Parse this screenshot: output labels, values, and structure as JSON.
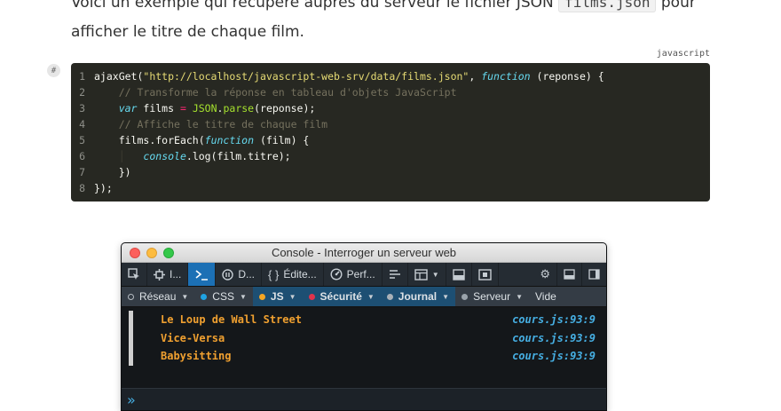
{
  "prose": {
    "line1_prefix": "Voici un exemple qui récupère auprès du serveur le fichier JSON ",
    "line1_code": "films.json",
    "line1_suffix": " pour",
    "line2": "afficher le titre de chaque film."
  },
  "code_block": {
    "language": "javascript",
    "anchor_label": "#",
    "lines": [
      {
        "n": "1"
      },
      {
        "n": "2"
      },
      {
        "n": "3"
      },
      {
        "n": "4"
      },
      {
        "n": "5"
      },
      {
        "n": "6"
      },
      {
        "n": "7"
      },
      {
        "n": "8"
      }
    ],
    "tokens": {
      "l1_a": "ajaxGet(",
      "l1_str": "\"http://localhost/javascript-web-srv/data/films.json\"",
      "l1_b": ", ",
      "l1_kw": "function",
      "l1_c": " (reponse) {",
      "l2_com": "// Transforme la réponse en tableau d'objets JavaScript",
      "l3_kw": "var",
      "l3_a": " films ",
      "l3_op": "=",
      "l3_sp": " ",
      "l3_obj": "JSON",
      "l3_b": ".",
      "l3_fn": "parse",
      "l3_c": "(reponse);",
      "l4_com": "// Affiche le titre de chaque film",
      "l5_a": "films.forEach(",
      "l5_kw": "function",
      "l5_b": " (film) {",
      "l6_kw": "console",
      "l6_a": ".log(film.titre);",
      "l7_a": "})",
      "l8_a": "});"
    }
  },
  "devtools": {
    "window_title": "Console - Interroger un serveur web",
    "toolbar": {
      "inspector": "I...",
      "debugger": "D...",
      "style_editor": "Édite...",
      "performance": "Perf..."
    },
    "filters": {
      "network": "Réseau",
      "css": "CSS",
      "js": "JS",
      "security": "Sécurité",
      "logging": "Journal",
      "server": "Serveur",
      "clear": "Vide"
    },
    "colors": {
      "network": "#b6bcc2",
      "css": "#1fa3e3",
      "js": "#f5a623",
      "security": "#e0334c",
      "logging": "#a9b1b8",
      "server": "#9aa3ab"
    },
    "logs": [
      {
        "text": "Le Loup de Wall Street",
        "source": "cours.js:93:9"
      },
      {
        "text": "Vice-Versa",
        "source": "cours.js:93:9"
      },
      {
        "text": "Babysitting",
        "source": "cours.js:93:9"
      }
    ],
    "prompt_icon": "double-chevron-icon"
  }
}
